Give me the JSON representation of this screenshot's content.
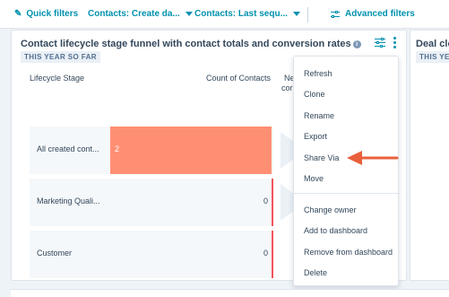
{
  "filters": {
    "quick_filters": "Quick filters",
    "contacts_create": "Contacts: Create da...",
    "contacts_last_seq": "Contacts: Last sequ...",
    "advanced": "Advanced filters"
  },
  "report": {
    "title": "Contact lifecycle stage funnel with contact totals and conversion rates",
    "period": "THIS YEAR SO FAR",
    "columns": {
      "stage": "Lifecycle Stage",
      "count": "Count of Contacts",
      "next_a": "Ne",
      "next_b": "cor"
    },
    "rows": [
      {
        "label": "All created cont...",
        "value": "2",
        "fill": 1.0
      },
      {
        "label": "Marketing Quali...",
        "value": "0",
        "fill": 0.0
      },
      {
        "label": "Customer",
        "value": "0",
        "fill": 0.0
      }
    ],
    "accent_color": "#ff8f73"
  },
  "menu": {
    "items": [
      "Refresh",
      "Clone",
      "Rename",
      "Export",
      "Share Via",
      "Move"
    ],
    "items2": [
      "Change owner",
      "Add to dashboard",
      "Remove from dashboard",
      "Delete"
    ]
  },
  "card2": {
    "title": "Deal clo",
    "period": "THIS YE"
  },
  "annotation": {
    "arrow_color": "#e8603c"
  }
}
